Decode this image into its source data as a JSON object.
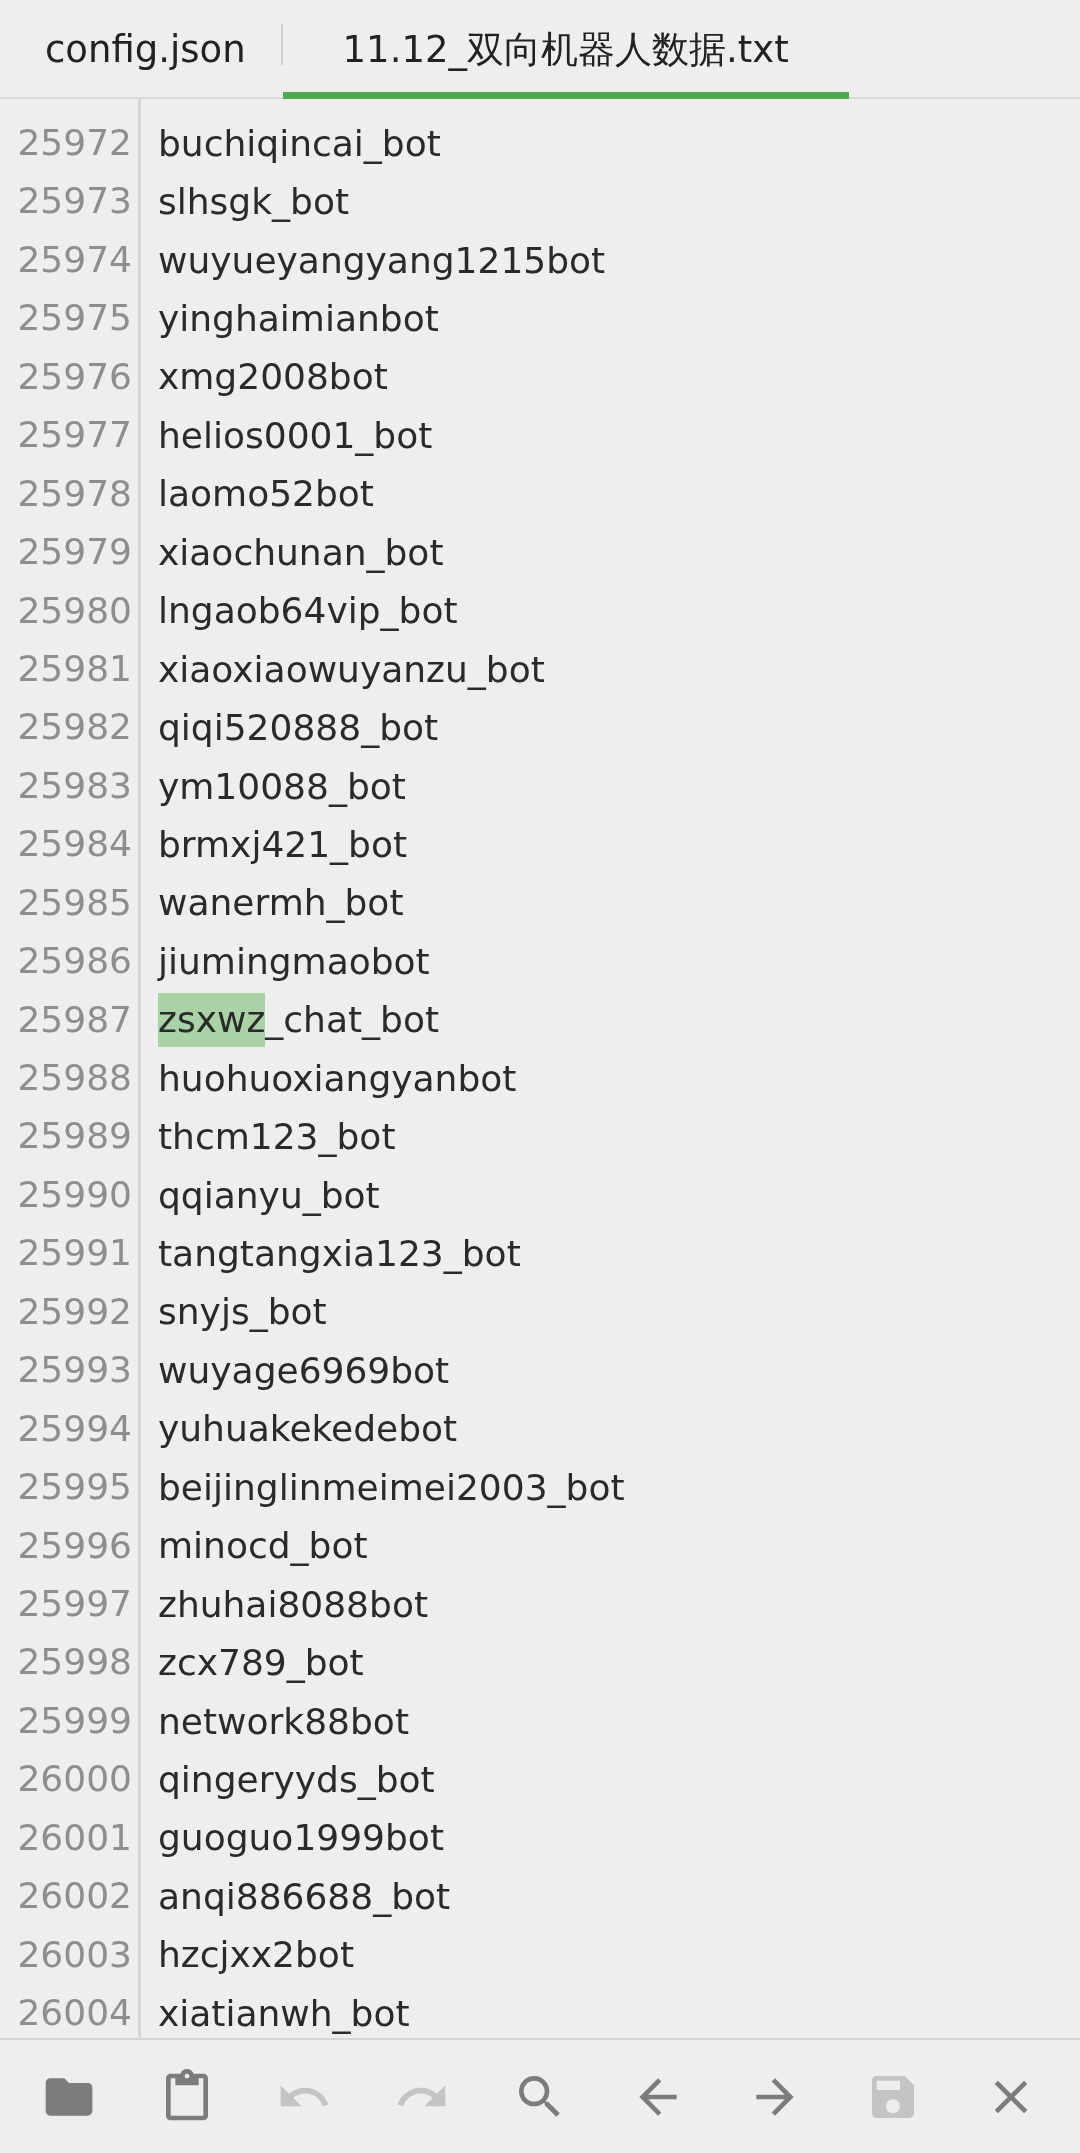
{
  "tabs": [
    {
      "label": "config.json",
      "selected": false
    },
    {
      "label": "11.12_双向机器人数据.txt",
      "selected": true
    }
  ],
  "lines": [
    {
      "number": "25972",
      "text": "buchiqincai_bot"
    },
    {
      "number": "25973",
      "text": "slhsgk_bot"
    },
    {
      "number": "25974",
      "text": "wuyueyangyang1215bot"
    },
    {
      "number": "25975",
      "text": "yinghaimianbot"
    },
    {
      "number": "25976",
      "text": "xmg2008bot"
    },
    {
      "number": "25977",
      "text": "helios0001_bot"
    },
    {
      "number": "25978",
      "text": "laomo52bot"
    },
    {
      "number": "25979",
      "text": "xiaochunan_bot"
    },
    {
      "number": "25980",
      "text": "lngaob64vip_bot"
    },
    {
      "number": "25981",
      "text": "xiaoxiaowuyanzu_bot"
    },
    {
      "number": "25982",
      "text": "qiqi520888_bot"
    },
    {
      "number": "25983",
      "text": "ym10088_bot"
    },
    {
      "number": "25984",
      "text": "brmxj421_bot"
    },
    {
      "number": "25985",
      "text": "wanermh_bot"
    },
    {
      "number": "25986",
      "text": "jiumingmaobot"
    },
    {
      "number": "25987",
      "match": "zsxwz",
      "text": "_chat_bot"
    },
    {
      "number": "25988",
      "text": "huohuoxiangyanbot"
    },
    {
      "number": "25989",
      "text": "thcm123_bot"
    },
    {
      "number": "25990",
      "text": "qqianyu_bot"
    },
    {
      "number": "25991",
      "text": "tangtangxia123_bot"
    },
    {
      "number": "25992",
      "text": "snyjs_bot"
    },
    {
      "number": "25993",
      "text": "wuyage6969bot"
    },
    {
      "number": "25994",
      "text": "yuhuakekedebot"
    },
    {
      "number": "25995",
      "text": "beijinglinmeimei2003_bot"
    },
    {
      "number": "25996",
      "text": "minocd_bot"
    },
    {
      "number": "25997",
      "text": "zhuhai8088bot"
    },
    {
      "number": "25998",
      "text": "zcx789_bot"
    },
    {
      "number": "25999",
      "text": "network88bot"
    },
    {
      "number": "26000",
      "text": "qingeryyds_bot"
    },
    {
      "number": "26001",
      "text": "guoguo1999bot"
    },
    {
      "number": "26002",
      "text": "anqi886688_bot"
    },
    {
      "number": "26003",
      "text": "hzcjxx2bot"
    },
    {
      "number": "26004",
      "text": "xiatianwh_bot"
    }
  ],
  "toolbar": [
    {
      "kind": "open",
      "disabled": false
    },
    {
      "kind": "paste",
      "disabled": false
    },
    {
      "kind": "undo",
      "disabled": true
    },
    {
      "kind": "redo",
      "disabled": true
    },
    {
      "kind": "search",
      "disabled": false
    },
    {
      "kind": "back",
      "disabled": false
    },
    {
      "kind": "forward",
      "disabled": false
    },
    {
      "kind": "save",
      "disabled": true
    },
    {
      "kind": "close",
      "disabled": false
    }
  ]
}
